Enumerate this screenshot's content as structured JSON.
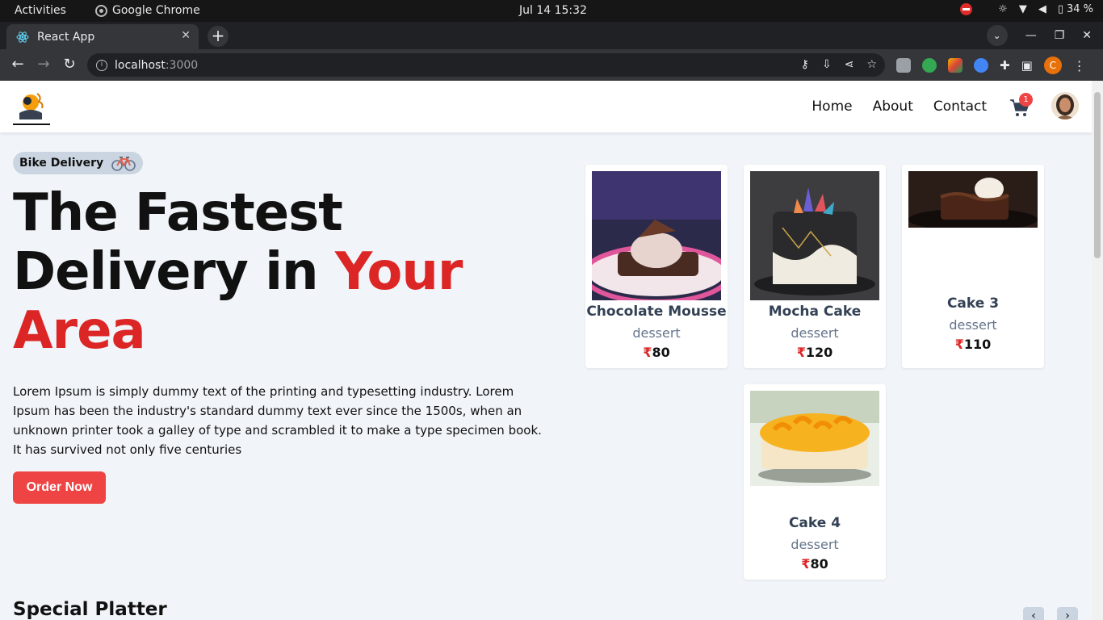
{
  "os": {
    "activities": "Activities",
    "app": "Google Chrome",
    "clock": "Jul 14  15:32",
    "battery": "34 %"
  },
  "browser": {
    "tab_title": "React App",
    "url_host": "localhost",
    "url_port": ":3000"
  },
  "nav": {
    "home": "Home",
    "about": "About",
    "contact": "Contact",
    "cart_count": "1"
  },
  "hero": {
    "badge": "Bike Delivery",
    "title_line1": "The Fastest",
    "title_line2a": "Delivery in ",
    "title_line2b": "Your",
    "title_line3": "Area",
    "description": "Lorem Ipsum is simply dummy text of the printing and typesetting industry. Lorem Ipsum has been the industry's standard dummy text ever since the 1500s, when an unknown printer took a galley of type and scrambled it to make a type specimen book. It has survived not only five centuries",
    "cta": "Order Now"
  },
  "cards": [
    {
      "name": "Chocolate Mousse",
      "category": "dessert",
      "currency": "₹",
      "price": "80"
    },
    {
      "name": "Mocha Cake",
      "category": "dessert",
      "currency": "₹",
      "price": "120"
    },
    {
      "name": "Cake 3",
      "category": "dessert",
      "currency": "₹",
      "price": "110"
    },
    {
      "name": "Cake 4",
      "category": "dessert",
      "currency": "₹",
      "price": "80"
    }
  ],
  "section": {
    "special": "Special Platter",
    "prev": "‹",
    "next": "›"
  },
  "colors": {
    "accent": "#ef4444",
    "price_symbol": "#dc2626",
    "page_bg": "#f1f5f9"
  }
}
